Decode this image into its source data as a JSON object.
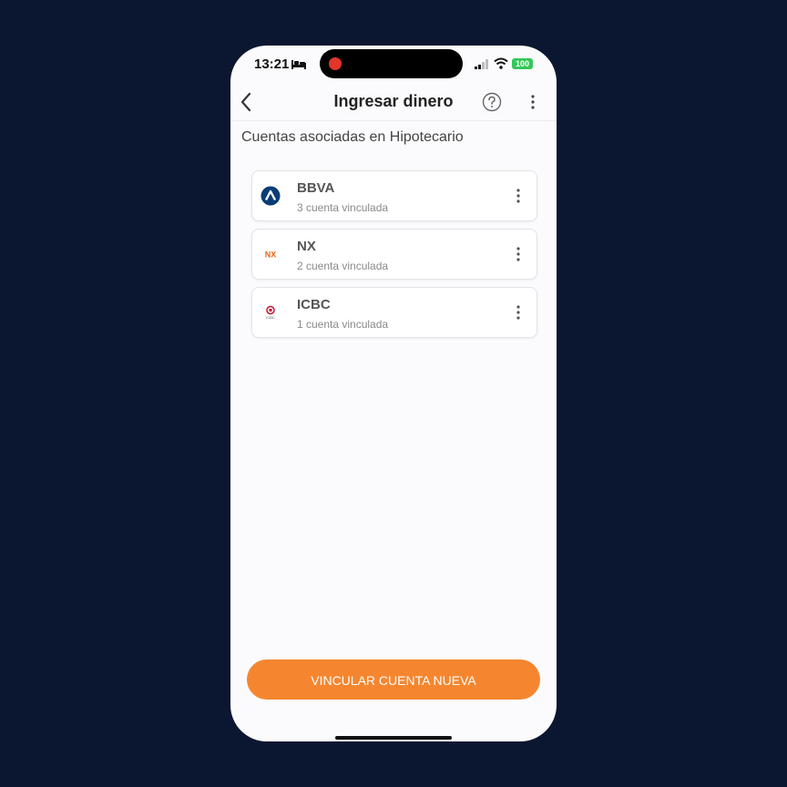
{
  "status_bar": {
    "time": "13:21",
    "battery": "100"
  },
  "nav": {
    "title": "Ingresar dinero"
  },
  "section_title": "Cuentas asociadas en Hipotecario",
  "accounts": [
    {
      "name": "BBVA",
      "subtitle": "3 cuenta vinculada",
      "logo": "bbva-logo",
      "logo_text": ""
    },
    {
      "name": "NX",
      "subtitle": "2 cuenta vinculada",
      "logo": "nx-logo",
      "logo_text": "NX"
    },
    {
      "name": "ICBC",
      "subtitle": "1 cuenta vinculada",
      "logo": "icbc-logo",
      "logo_text": "ICBC"
    }
  ],
  "cta_label": "VINCULAR CUENTA NUEVA",
  "colors": {
    "accent": "#f5862f",
    "background": "#0b1730",
    "screen": "#fbfbfd",
    "battery": "#34c759",
    "bbva_blue": "#0a3c78",
    "nx_orange": "#e8651a",
    "icbc_red": "#c8102e"
  },
  "icons": [
    "back-icon",
    "help-icon",
    "more-vertical-icon",
    "signal-icon",
    "wifi-icon",
    "bed-icon"
  ]
}
